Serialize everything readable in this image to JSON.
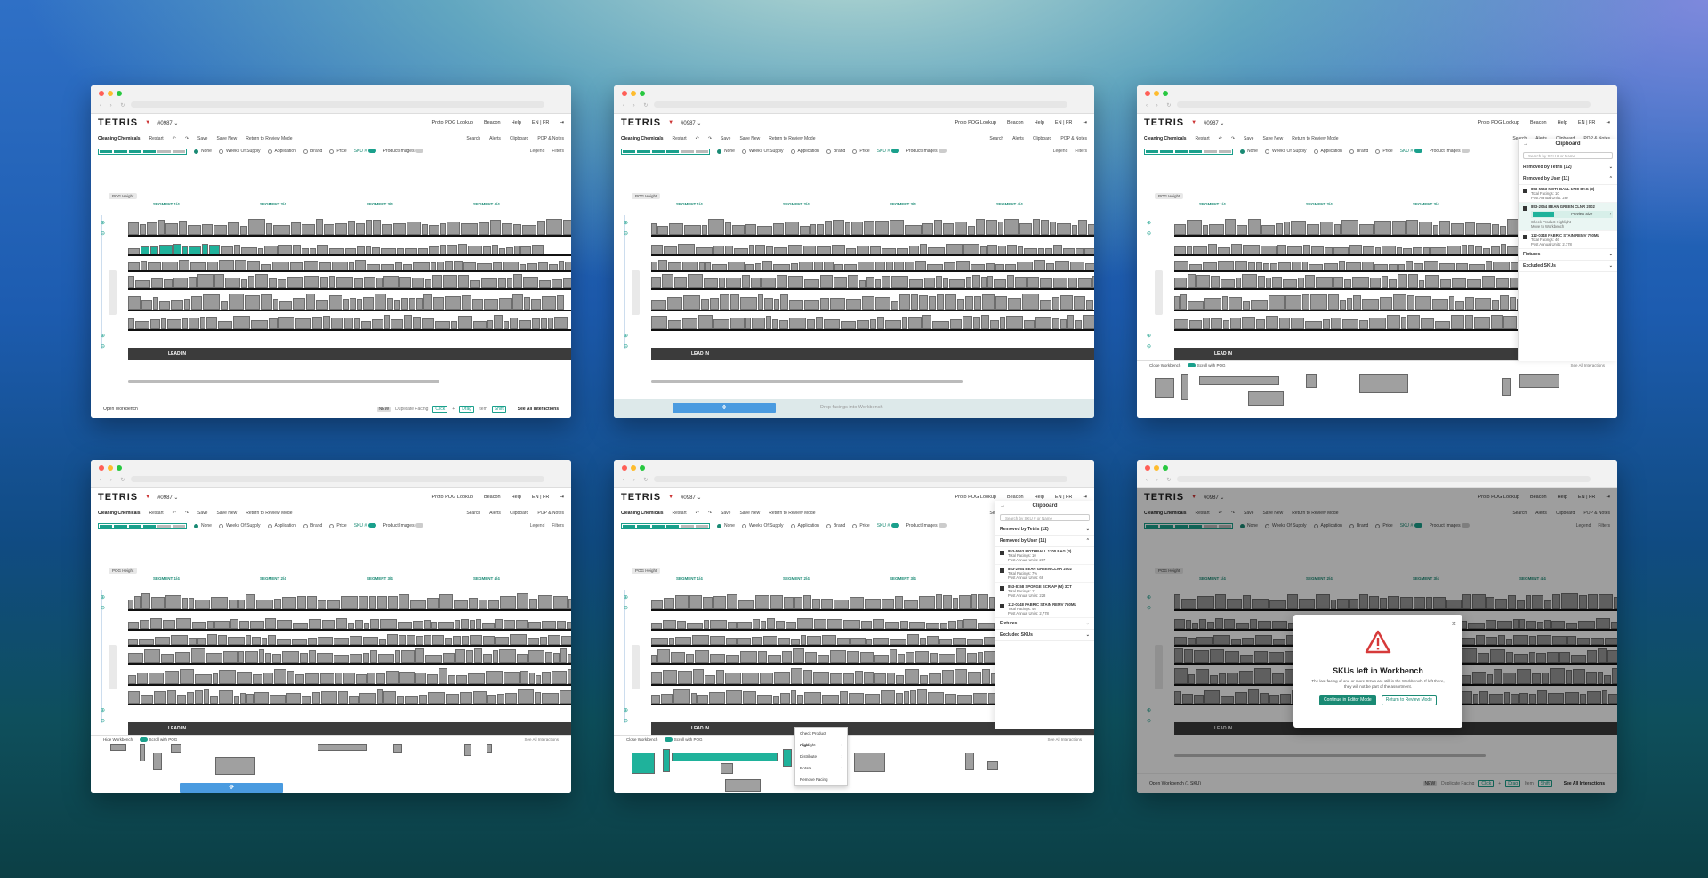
{
  "app": {
    "logo": "TETRIS",
    "store": "#0987 ⌄",
    "header_links": [
      "Proto POG Lookup",
      "Beacon",
      "Help",
      "EN | FR"
    ],
    "category": "Cleaning Chemicals",
    "toolbar": [
      "Restart",
      "↶",
      "↷",
      "Save",
      "Save New",
      "Return to Review Mode"
    ],
    "toolbar_right": [
      "Search",
      "Alerts",
      "Clipboard",
      "POP & Notes"
    ],
    "highlight_options": [
      "None",
      "Weeks Of Supply",
      "Application",
      "Brand",
      "Price"
    ],
    "sku_toggle": "SKU #",
    "product_images": "Product Images",
    "legend": "Legend",
    "filters": "Filters",
    "pog_height": "POG Height",
    "segments": [
      "SEGMENT 1/4",
      "SEGMENT 2/4",
      "SEGMENT 3/4",
      "SEGMENT 4/4"
    ],
    "lead_in": "LEAD IN"
  },
  "footer": {
    "open_workbench": "Open Workbench",
    "new_badge": "NEW",
    "duplicate_facing": "Duplicate Facing",
    "click": "Click",
    "plus": "+",
    "drag": "Drag",
    "item": "Item",
    "shift": "Shift",
    "see_all": "See All Interactions"
  },
  "drop": {
    "label": "Drop facings into Workbench"
  },
  "workbench": {
    "close": "Close Workbench",
    "hide": "Hide Workbench",
    "scroll_with_pog": "Scroll with POG",
    "see_all": "See All Interactions"
  },
  "clipboard": {
    "title": "Clipboard",
    "search_placeholder": "Search by SKU # or Name",
    "removed_by_tetris": "Removed by Tetris (12)",
    "removed_by_user": "Removed by User (11)",
    "items": [
      {
        "name": "853-5563 MOTHBALL 1700 BAG (3)",
        "facings": "Total Facings: 10",
        "units": "Post Annual Units: 287"
      },
      {
        "name": "853-2054 BEAN GREEN CLNR 2002",
        "facings": "Total Facings: 7%",
        "units": "Post Annual Units: 68"
      },
      {
        "name": "853-8158 SPONGE SCR AP (M) 3CT",
        "facings": "Total Facings: 11",
        "units": "Post Annual Units: 228"
      },
      {
        "name": "112-0348 FABRIC STAIN REMV 750ML",
        "facings": "Total Facings: 46",
        "units": "Post Annual Units: 2,778"
      }
    ],
    "fixtures": "Fixtures",
    "excluded": "Excluded SKUs",
    "ctx": [
      "Preview Size",
      "Check Product Highlight",
      "Move to Workbench"
    ]
  },
  "context_menu": [
    "Check Product Highlight",
    "Align",
    "Distribute",
    "Rotate",
    "Remove Facing"
  ],
  "modal": {
    "title": "SKUs left in Workbench",
    "body": "The last facing of one or more SKUs are still in the Workbench. If left there, they will not be part of the assortment.",
    "primary": "Continue in Editor Mode",
    "secondary": "Return to Review Mode",
    "open_workbench_count": "Open Workbench (1 SKU)"
  },
  "colors": {
    "accent": "#1a8a74",
    "teal": "#1fb29b",
    "drop_bar": "#4a9be0"
  }
}
